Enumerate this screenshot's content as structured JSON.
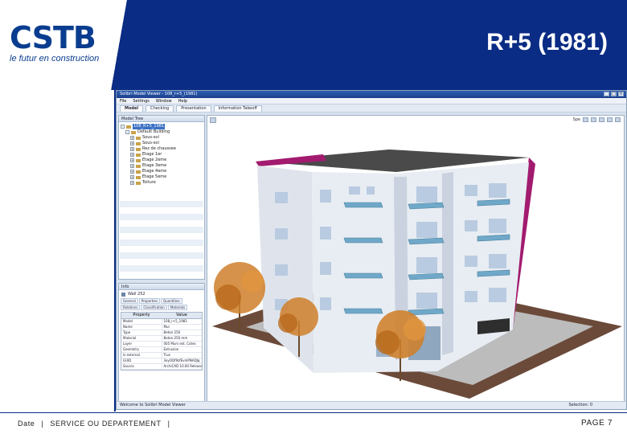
{
  "slide": {
    "logo_word": "CSTB",
    "logo_tagline": "le futur en construction",
    "title": "R+5 (1981)",
    "footer_date": "Date",
    "footer_department": "SERVICE OU DEPARTEMENT",
    "page_label": "PAGE 7",
    "brand_color": "#0b2c84"
  },
  "app": {
    "window_title": "Solibri Model Viewer - 108_r+5_(1981)",
    "menu": [
      "File",
      "Settings",
      "Window",
      "Help"
    ],
    "tabs": [
      "Model",
      "Checking",
      "Presentation",
      "Information Takeoff"
    ],
    "tree_panel_title": "Model Tree",
    "tree_root": "108_R+5_1981",
    "tree_building": "Default Building",
    "tree_items": [
      "Sous-sol",
      "Sous-sol",
      "Rez de chaussee",
      "Etage 1er",
      "Etage 2eme",
      "Etage 3eme",
      "Etage 4eme",
      "Etage 5eme",
      "Toiture"
    ],
    "info_panel_title": "Info",
    "info_element": "Wall 252",
    "info_subtabs": [
      "General",
      "Properties",
      "Quantities",
      "Relations",
      "Classification",
      "Materials"
    ],
    "props_headers": [
      "Property",
      "Value"
    ],
    "props_rows": [
      [
        "Model",
        "108_r+5_1981"
      ],
      [
        "Name",
        "Mur"
      ],
      [
        "Type",
        "Beton 250"
      ],
      [
        "Material",
        "Beton 250 mm"
      ],
      [
        "Layer",
        "005 Murs ext. Cotes"
      ],
      [
        "Geometry",
        "Extrusion"
      ],
      [
        "Is external",
        "True"
      ],
      [
        "GUID",
        "3eyOQf9zfEvmPNADJq"
      ],
      [
        "Source",
        "ArchiCAD 10.00 Release"
      ]
    ],
    "viewport_toolbar": [
      "Spe",
      "",
      "",
      "",
      "",
      ""
    ],
    "status_left": "Welcome to Solibri Model Viewer",
    "status_right": "Selection: 0"
  }
}
